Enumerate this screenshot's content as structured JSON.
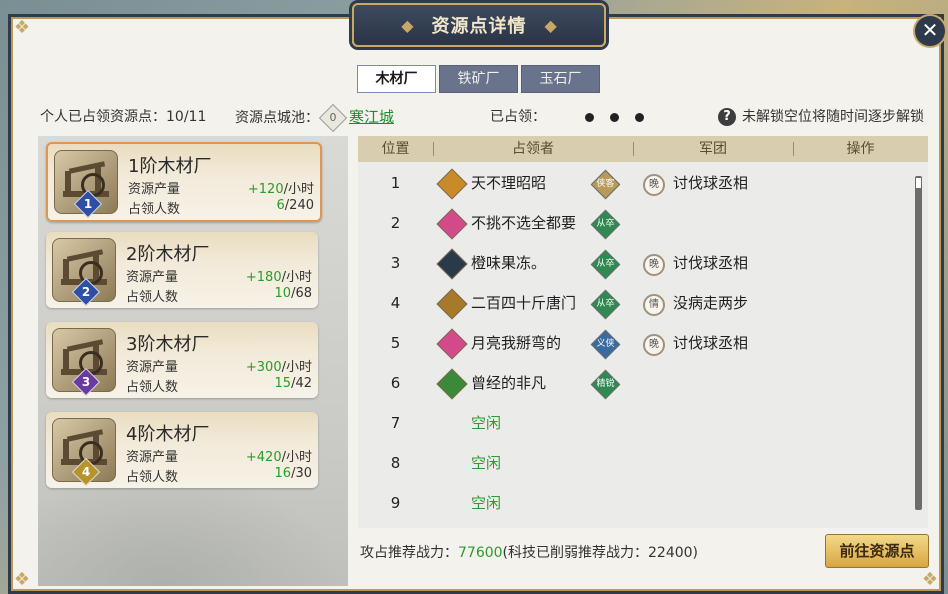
{
  "title": "资源点详情",
  "close_icon": "close-icon",
  "tabs": [
    {
      "label": "木材厂",
      "active": true
    },
    {
      "label": "铁矿厂",
      "active": false
    },
    {
      "label": "玉石厂",
      "active": false
    }
  ],
  "info": {
    "occupied_label": "个人已占领资源点：10/11",
    "city_label": "资源点城池：",
    "city_badge": "0",
    "city_name": "寒江城",
    "owned_label": "已占领：",
    "hint": "未解锁空位将随时间逐步解锁",
    "hint_icon": "?"
  },
  "cards": [
    {
      "name": "1阶木材厂",
      "level": "1",
      "prod_label": "资源产量",
      "prod_value": "+120",
      "prod_unit": "/小时",
      "occ_label": "占领人数",
      "occ_current": "6",
      "occ_total": "/240",
      "level_color": "#2d4fa6",
      "selected": true
    },
    {
      "name": "2阶木材厂",
      "level": "2",
      "prod_label": "资源产量",
      "prod_value": "+180",
      "prod_unit": "/小时",
      "occ_label": "占领人数",
      "occ_current": "10",
      "occ_total": "/68",
      "level_color": "#2d4fa6",
      "selected": false
    },
    {
      "name": "3阶木材厂",
      "level": "3",
      "prod_label": "资源产量",
      "prod_value": "+300",
      "prod_unit": "/小时",
      "occ_label": "占领人数",
      "occ_current": "15",
      "occ_total": "/42",
      "level_color": "#6a3aa0",
      "selected": false
    },
    {
      "name": "4阶木材厂",
      "level": "4",
      "prod_label": "资源产量",
      "prod_value": "+420",
      "prod_unit": "/小时",
      "occ_label": "占领人数",
      "occ_current": "16",
      "occ_total": "/30",
      "level_color": "#b8922a",
      "selected": false
    }
  ],
  "table": {
    "headers": [
      "位置",
      "占领者",
      "军团",
      "操作"
    ],
    "rows": [
      {
        "pos": "1",
        "name": "天不理昭昭",
        "role_color": "#c98a2a",
        "tag": "侠客",
        "tag_color": "#b89a5a",
        "legion": "讨伐球丞相",
        "legion_icon": "晚"
      },
      {
        "pos": "2",
        "name": "不挑不选全都要",
        "role_color": "#d24a8a",
        "tag": "从卒",
        "tag_color": "#2e8a52",
        "legion": "",
        "legion_icon": ""
      },
      {
        "pos": "3",
        "name": "橙味果冻。",
        "role_color": "#2a3a4a",
        "tag": "从卒",
        "tag_color": "#2e8a52",
        "legion": "讨伐球丞相",
        "legion_icon": "晚"
      },
      {
        "pos": "4",
        "name": "二百四十斤唐门",
        "role_color": "#a67a2a",
        "tag": "从卒",
        "tag_color": "#2e8a52",
        "legion": "没病走两步",
        "legion_icon": "情"
      },
      {
        "pos": "5",
        "name": "月亮我掰弯的",
        "role_color": "#d24a8a",
        "tag": "义侠",
        "tag_color": "#3a6aa0",
        "legion": "讨伐球丞相",
        "legion_icon": "晚"
      },
      {
        "pos": "6",
        "name": "曾经的非凡",
        "role_color": "#3a8a3a",
        "tag": "精锐",
        "tag_color": "#2e8a52",
        "legion": "",
        "legion_icon": ""
      },
      {
        "pos": "7",
        "idle": "空闲"
      },
      {
        "pos": "8",
        "idle": "空闲"
      },
      {
        "pos": "9",
        "idle": "空闲"
      }
    ]
  },
  "footer": {
    "label": "攻占推荐战力：",
    "value": "77600",
    "note": "(科技已削弱推荐战力：22400)"
  },
  "go_button": "前往资源点"
}
